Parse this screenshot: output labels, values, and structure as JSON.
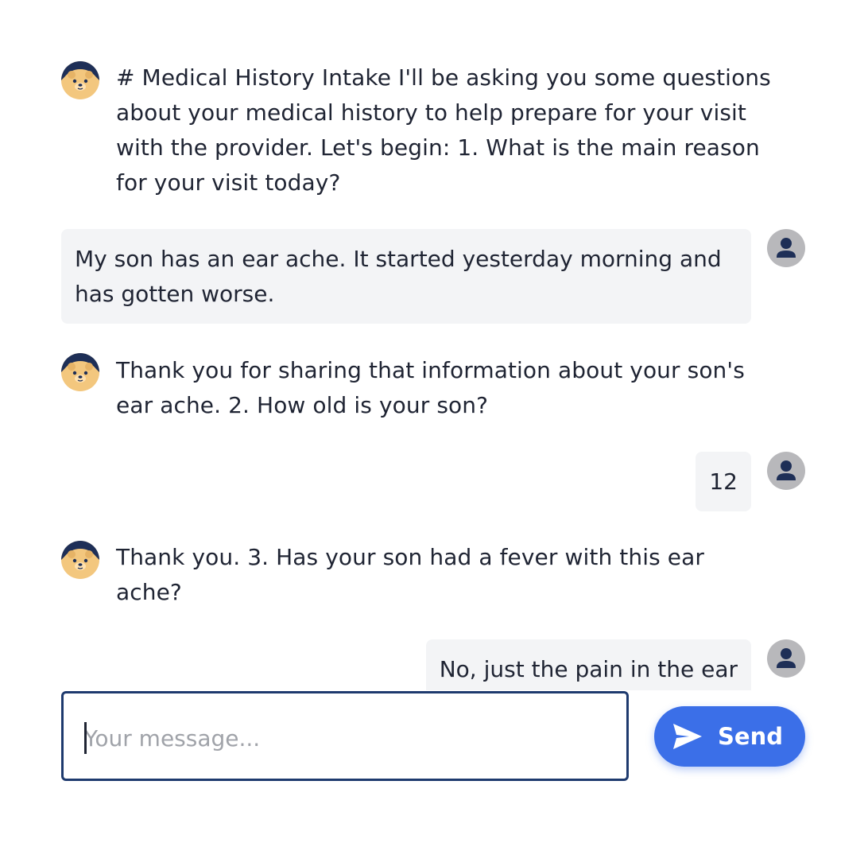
{
  "messages": {
    "bot_1": "# Medical History Intake I'll be asking you some questions about your medical history to help prepare for your visit with the provider. Let's begin: 1. What is the main reason for your visit today?",
    "user_1": "My son has an ear ache. It started yesterday morning and has gotten worse.",
    "bot_2": "Thank you for sharing that information about your son's ear ache. 2. How old is your son?",
    "user_2": "12",
    "bot_3": "Thank you. 3. Has your son had a fever with this ear ache?",
    "user_3": "No, just the pain in the ear"
  },
  "composer": {
    "placeholder": "Your message...",
    "value": "",
    "send_label": "Send"
  },
  "icons": {
    "bot_avatar": "bear-avatar-icon",
    "user_avatar": "person-icon",
    "send": "paper-plane-icon"
  },
  "colors": {
    "accent": "#3b6fe8",
    "input_border": "#1e3a6e",
    "bubble_bg": "#f3f4f6",
    "user_avatar_bg": "#b8b8bb",
    "text": "#1f2433"
  }
}
